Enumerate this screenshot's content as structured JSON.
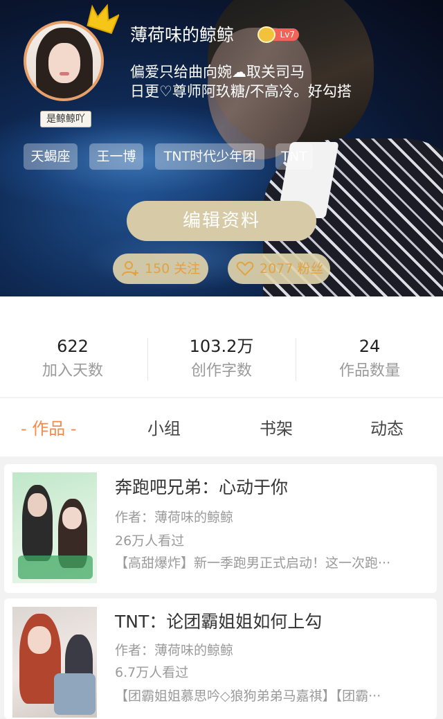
{
  "profile": {
    "avatar_tag": "是鲸鲸吖",
    "name": "薄荷味的鲸鲸",
    "level": "Lv7",
    "bio_line1": "偏爱只给曲向婉☁取关司马",
    "bio_line2": "日更♡尊师阿玖糖/不高冷。好勾搭",
    "tags": [
      "天蝎座",
      "王一博",
      "TNT时代少年团",
      "TNT"
    ],
    "edit_button": "编辑资料",
    "following": "150 关注",
    "followers": "2077 粉丝"
  },
  "stats": [
    {
      "value": "622",
      "label": "加入天数"
    },
    {
      "value": "103.2万",
      "label": "创作字数"
    },
    {
      "value": "24",
      "label": "作品数量"
    }
  ],
  "tabs": [
    {
      "label": "- 作品 -",
      "active": true
    },
    {
      "label": "小组",
      "active": false
    },
    {
      "label": "书架",
      "active": false
    },
    {
      "label": "动态",
      "active": false
    }
  ],
  "works": [
    {
      "title": "奔跑吧兄弟：心动于你",
      "author": "作者：薄荷味的鲸鲸",
      "views": "26万人看过",
      "desc": "【高甜爆炸】新一季跑男正式启动！这一次跑···"
    },
    {
      "title": "TNT：论团霸姐姐如何上勾",
      "author": "作者：薄荷味的鲸鲸",
      "views": "6.7万人看过",
      "desc": "【团霸姐姐慕思吟◇狼狗弟弟马嘉祺】【团霸···"
    }
  ],
  "colors": {
    "accent": "#f28a4b",
    "edit_button_bg": "#d6cba6",
    "pill_text": "#e2a23f",
    "level_badge": "#f0645a"
  }
}
